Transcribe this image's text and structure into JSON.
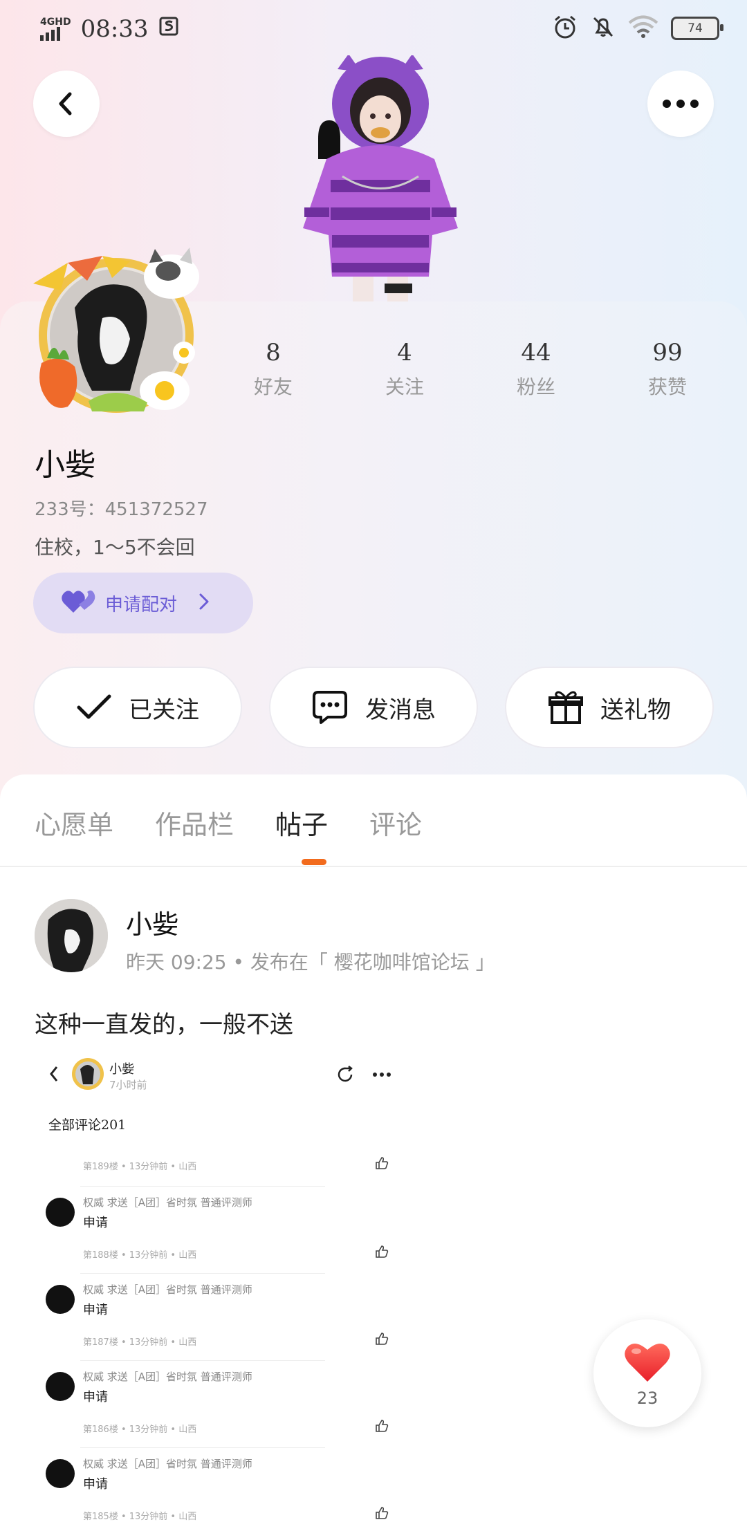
{
  "status_bar": {
    "network": "4GHD",
    "time": "08:33",
    "battery": "74"
  },
  "profile": {
    "stats": [
      {
        "value": "8",
        "label": "好友"
      },
      {
        "value": "4",
        "label": "关注"
      },
      {
        "value": "44",
        "label": "粉丝"
      },
      {
        "value": "99",
        "label": "获赞"
      }
    ],
    "name": "小姕",
    "id_text": "233号：451372527",
    "bio": "住校，1～5不会回",
    "pair_button": "申请配对"
  },
  "actions": {
    "followed": "已关注",
    "message": "发消息",
    "gift": "送礼物"
  },
  "tabs": [
    "心愿单",
    "作品栏",
    "帖子",
    "评论"
  ],
  "active_tab": "帖子",
  "post": {
    "author": "小姕",
    "meta": "昨天 09:25 • 发布在「 樱花咖啡馆论坛 」",
    "text": "这种一直发的，一般不送",
    "screenshot": {
      "name": "小姕",
      "time": "7小时前",
      "title": "全部评论201",
      "first_floor": "第189楼 • 13分钟前 • 山西",
      "rows": [
        {
          "who": "权威 求送［A团］省时氛  普通评测师",
          "msg": "申请",
          "floor": "第188楼 • 13分钟前 • 山西"
        },
        {
          "who": "权威 求送［A团］省时氛  普通评测师",
          "msg": "申请",
          "floor": "第187楼 • 13分钟前 • 山西"
        },
        {
          "who": "权威 求送［A团］省时氛  普通评测师",
          "msg": "申请",
          "floor": "第186楼 • 13分钟前 • 山西"
        },
        {
          "who": "权威 求送［A团］省时氛  普通评测师",
          "msg": "申请",
          "floor": "第185楼 • 13分钟前 • 山西"
        }
      ]
    }
  },
  "like": {
    "count": "23"
  },
  "colors": {
    "accent": "#f26b1d",
    "pair_purple": "#6b5cd6",
    "heart": "#f0322f"
  }
}
